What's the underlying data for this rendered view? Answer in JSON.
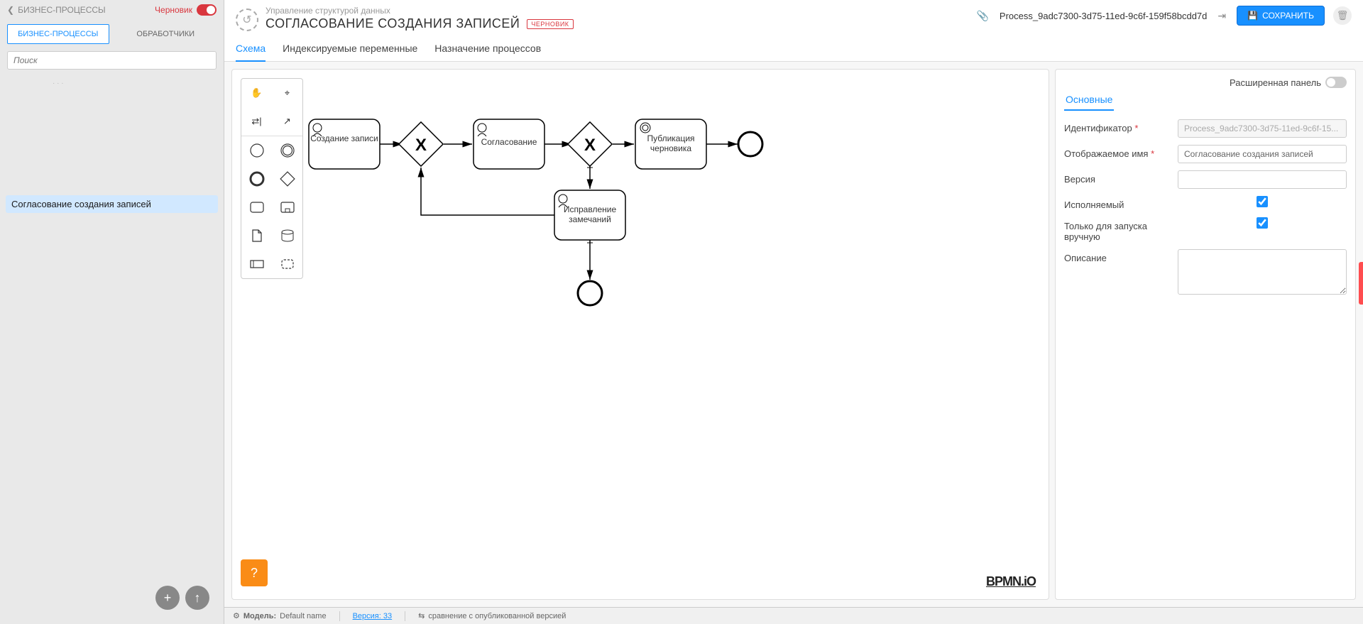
{
  "sidebar": {
    "title": "БИЗНЕС-ПРОЦЕССЫ",
    "draft_label": "Черновик",
    "tabs": {
      "bp": "БИЗНЕС-ПРОЦЕССЫ",
      "handlers": "ОБРАБОТЧИКИ"
    },
    "search_placeholder": "Поиск",
    "tree": {
      "selected": "Согласование создания записей"
    }
  },
  "header": {
    "breadcrumb": "Управление структурой данных",
    "title": "СОГЛАСОВАНИЕ СОЗДАНИЯ ЗАПИСЕЙ",
    "draft_badge": "ЧЕРНОВИК",
    "process_id": "Process_9adc7300-3d75-11ed-9c6f-159f58bcdd7d",
    "save": "СОХРАНИТЬ",
    "tabs": {
      "scheme": "Схема",
      "vars": "Индексируемые переменные",
      "assign": "Назначение процессов"
    }
  },
  "diagram": {
    "nodes": {
      "create": "Создание записи",
      "approve": "Согласование",
      "publish": "Публикация черновика",
      "fix": "Исправление замечаний"
    },
    "logo": "BPMN.iO"
  },
  "props": {
    "extended_label": "Расширенная панель",
    "section": "Основные",
    "fields": {
      "identifier_label": "Идентификатор",
      "identifier_value": "Process_9adc7300-3d75-11ed-9c6f-15...",
      "display_name_label": "Отображаемое имя",
      "display_name_value": "Согласование создания записей",
      "version_label": "Версия",
      "version_value": "",
      "executable_label": "Исполняемый",
      "manual_only_label": "Только для запуска вручную",
      "description_label": "Описание"
    }
  },
  "status": {
    "model_label": "Модель:",
    "model_value": "Default name",
    "version_label": "Версия:",
    "version_value": "33",
    "compare": "сравнение с опубликованной версией"
  }
}
